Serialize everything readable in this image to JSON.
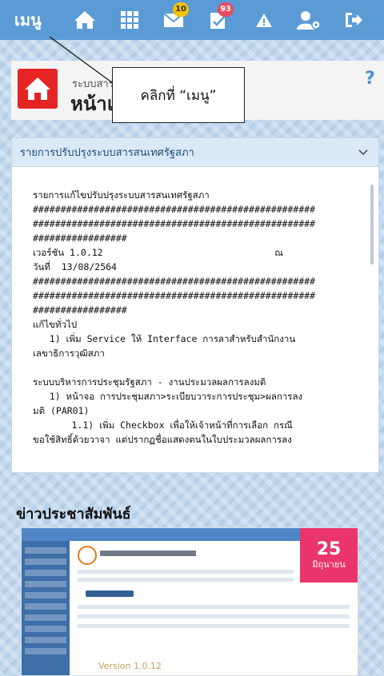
{
  "topbar": {
    "menu_label": "เมนู",
    "icons": [
      {
        "name": "home-icon"
      },
      {
        "name": "grid-icon"
      },
      {
        "name": "mail-icon",
        "badge": "10",
        "badge_color": "#f2c200"
      },
      {
        "name": "approve-icon",
        "badge": "93",
        "badge_color": "#e84a5f"
      },
      {
        "name": "alert-icon"
      },
      {
        "name": "user-settings-icon"
      },
      {
        "name": "logout-icon"
      }
    ]
  },
  "header": {
    "subtitle": "ระบบสาร",
    "title": "หน้าแร",
    "help": "?"
  },
  "callout": {
    "text": "คลิกที่ “เมนู”"
  },
  "update_panel": {
    "title": "รายการปรับปรุงระบบสารสนเทศรัฐสภา",
    "body": "รายการแก้ไขปรับปรุงระบบสารสนเทศรัฐสภา\n###################################################\n###################################################\n#################\nเวอร์ชัน 1.0.12                               ณ\nวันที่  13/08/2564\n###################################################\n###################################################\n#################\nแก้ไขทั่วไป\n   1) เพิ่ม Service ให้ Interface การลาสำหรับสำนักงาน\nเลขาธิการวุฒิสภา\n\nระบบบริหารการประชุมรัฐสภา - งานประมวลผลการลงมติ\n   1) หน้าจอ การประชุมสภา>ระเบียบวาระการประชุม>ผลการลง\nมติ (PAR01)\n       1.1) เพิ่ม Checkbox เพื่อให้เจ้าหน้าที่การเลือก กรณี\nขอใช้สิทธิ์ด้วยวาจา แต่ปรากฏชื่อแสดงตนในใบประมวลผลการลง"
  },
  "news": {
    "title": "ข่าวประชาสัมพันธ์",
    "date_day": "25",
    "date_month": "มิถุนายน",
    "version_text": "Version 1.0.12"
  },
  "colors": {
    "topbar": "#5b9bd5",
    "home_tile": "#e52425",
    "date_badge": "#e9356b"
  }
}
